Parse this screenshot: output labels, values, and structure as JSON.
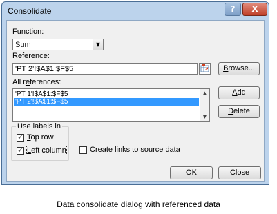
{
  "window": {
    "title": "Consolidate",
    "help_glyph": "?",
    "close_glyph": "X"
  },
  "function": {
    "label_first": "F",
    "label_rest": "unction:",
    "value": "Sum"
  },
  "reference": {
    "label_first": "R",
    "label_rest": "eference:",
    "value": "'PT 2'!$A$1:$F$5",
    "browse_first": "B",
    "browse_rest": "rowse..."
  },
  "all_references": {
    "label_pre": "All r",
    "label_key": "e",
    "label_post": "ferences:",
    "items": [
      {
        "text": "'PT 1'!$A$1:$F$5",
        "selected": false
      },
      {
        "text": "'PT 2'!$A$1:$F$5",
        "selected": true
      }
    ]
  },
  "buttons": {
    "add_first": "A",
    "add_rest": "dd",
    "delete_first": "D",
    "delete_rest": "elete",
    "ok": "OK",
    "close": "Close"
  },
  "use_labels": {
    "title": "Use labels in",
    "top_row_first": "T",
    "top_row_rest": "op row",
    "top_row_checked": true,
    "left_column_first": "L",
    "left_column_rest": "eft column",
    "left_column_checked": true
  },
  "links": {
    "label_pre": "Create links to ",
    "label_key": "s",
    "label_post": "ource data",
    "checked": false
  },
  "caption": "Data consolidate dialog with referenced data",
  "colors": {
    "selection": "#3399ff",
    "frame": "#bcd3ec",
    "close_button": "#c0402a"
  }
}
